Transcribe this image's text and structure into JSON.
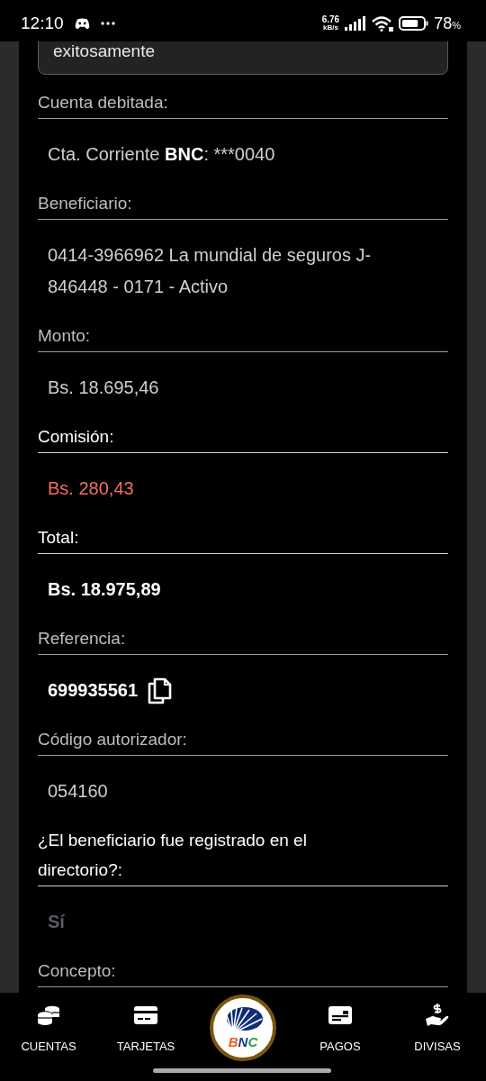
{
  "status_bar": {
    "time": "12:10",
    "speed_value": "6.76",
    "speed_unit": "kB/s",
    "battery": "78",
    "battery_unit": "%"
  },
  "message_box": {
    "text": "exitosamente"
  },
  "fields": [
    {
      "label": "Cuenta debitada:",
      "label_bright": false,
      "value": "Cta. Corriente **BNC**: ***0040",
      "kind": "plain"
    },
    {
      "label": "Beneficiario:",
      "label_bright": false,
      "value": "0414-3966962 La mundial de seguros J-846448 - 0171 - Activo",
      "kind": "plain"
    },
    {
      "label": "Monto:",
      "label_bright": false,
      "value": "Bs. 18.695,46",
      "kind": "plain"
    },
    {
      "label": "Comisión:",
      "label_bright": true,
      "value": "Bs. 280,43",
      "kind": "alert"
    },
    {
      "label": "Total:",
      "label_bright": true,
      "value": "Bs. 18.975,89",
      "kind": "bold"
    },
    {
      "label": "Referencia:",
      "label_bright": false,
      "value": "699935561",
      "kind": "bold",
      "copyable": true
    },
    {
      "label": "Código autorizador:",
      "label_bright": false,
      "value": "054160",
      "kind": "plain"
    },
    {
      "label": "¿El beneficiario fue registrado en el directorio?:",
      "label_bright": true,
      "value": "Sí",
      "kind": "muted"
    },
    {
      "label": "Concepto:",
      "label_bright": false
    }
  ],
  "bottom_nav": [
    {
      "label": "CUENTAS",
      "kind": "coins"
    },
    {
      "label": "TARJETAS",
      "kind": "card"
    },
    {
      "label": "BNC",
      "kind": "logo"
    },
    {
      "label": "PAGOS",
      "kind": "payment"
    },
    {
      "label": "DIVISAS",
      "kind": "currency"
    }
  ]
}
